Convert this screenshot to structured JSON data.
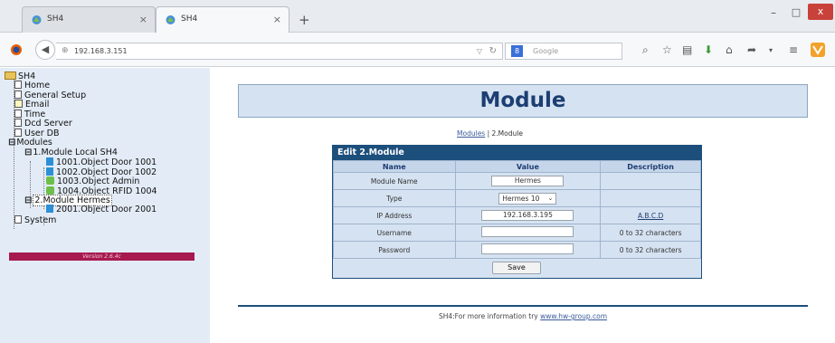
{
  "browser": {
    "tabs": [
      {
        "title": "SH4",
        "active": false
      },
      {
        "title": "SH4",
        "active": true
      }
    ],
    "new_tab": "+",
    "window": {
      "minimize": "–",
      "maximize": "□",
      "close": "x"
    },
    "url": "192.168.3.151",
    "search_placeholder": "Google",
    "search_engine_letter": "8",
    "icons": [
      "search-icon",
      "star-icon",
      "clipboard-icon",
      "download-icon",
      "home-icon",
      "send-icon",
      "menu-icon",
      "vivaldi-icon"
    ]
  },
  "tree": {
    "root": "SH4",
    "items": [
      "Home",
      "General Setup",
      "Email",
      "Time",
      "Dcd Server",
      "User DB"
    ],
    "modules_label": "Modules",
    "module1": {
      "label": "1.Module Local SH4",
      "doors": [
        "1001.Object Door 1001",
        "1002.Object Door 1002",
        "1003.Object Admin",
        "1004.Object RFID 1004"
      ]
    },
    "module2": {
      "label": "2.Module Hermes",
      "doors": [
        "2001.Object Door 2001"
      ]
    },
    "system": "System",
    "version": "Version 2.6.4c"
  },
  "page": {
    "title": "Module",
    "breadcrumb_link": "Modules",
    "breadcrumb_sep": " | ",
    "breadcrumb_current": "2.Module",
    "panel_title": "Edit 2.Module",
    "headers": {
      "name": "Name",
      "value": "Value",
      "description": "Description"
    },
    "rows": {
      "module_name": {
        "label": "Module Name",
        "value": "Hermes",
        "desc": ""
      },
      "type": {
        "label": "Type",
        "value": "Hermes 10",
        "desc": ""
      },
      "ip": {
        "label": "IP Address",
        "value": "192.168.3.195",
        "desc": "A.B.C.D"
      },
      "username": {
        "label": "Username",
        "value": "",
        "desc": "0 to 32 characters"
      },
      "password": {
        "label": "Password",
        "value": "",
        "desc": "0 to 32 characters"
      }
    },
    "save_label": "Save",
    "footer_prefix": "SH4:For more information try ",
    "footer_link": "www.hw-group.com"
  }
}
